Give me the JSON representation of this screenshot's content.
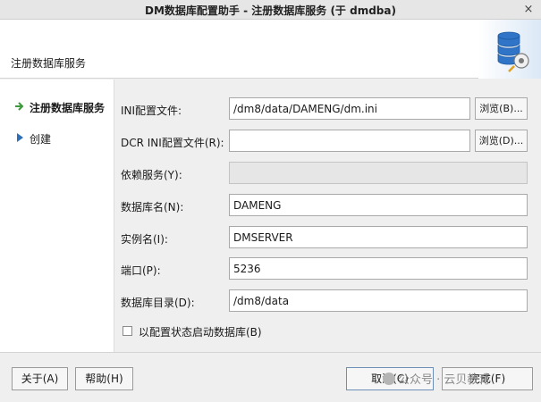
{
  "window": {
    "title": "DM数据库配置助手 - 注册数据库服务 (于 dmdba)",
    "close_glyph": "×"
  },
  "header": {
    "title": "注册数据库服务",
    "logo_icon": "database-gear-icon"
  },
  "sidebar": {
    "items": [
      {
        "label": "注册数据库服务",
        "active": true,
        "icon": "green-arrow-icon"
      },
      {
        "label": "创建",
        "active": false,
        "icon": "blue-triangle-icon"
      }
    ]
  },
  "form": {
    "ini": {
      "label": "INI配置文件:",
      "value": "/dm8/data/DAMENG/dm.ini",
      "browse": "浏览(B)..."
    },
    "dcr": {
      "label": "DCR INI配置文件(R):",
      "value": "",
      "browse": "浏览(D)..."
    },
    "depend": {
      "label": "依赖服务(Y):",
      "value": ""
    },
    "dbname": {
      "label": "数据库名(N):",
      "value": "DAMENG"
    },
    "instance": {
      "label": "实例名(I):",
      "value": "DMSERVER"
    },
    "port": {
      "label": "端口(P):",
      "value": "5236"
    },
    "dbdir": {
      "label": "数据库目录(D):",
      "value": "/dm8/data"
    },
    "start_checkbox": {
      "label": "以配置状态启动数据库(B)",
      "checked": false
    }
  },
  "footer": {
    "about": "关于(A)",
    "help": "帮助(H)",
    "cancel": "取消(C)",
    "finish": "完成(F)"
  },
  "watermark": {
    "text": "公众号 · 云贝教育"
  },
  "colors": {
    "accent": "#3a7bd5",
    "nav_arrow_green": "#3c9a3c",
    "nav_triangle_blue": "#2f6fb5"
  }
}
